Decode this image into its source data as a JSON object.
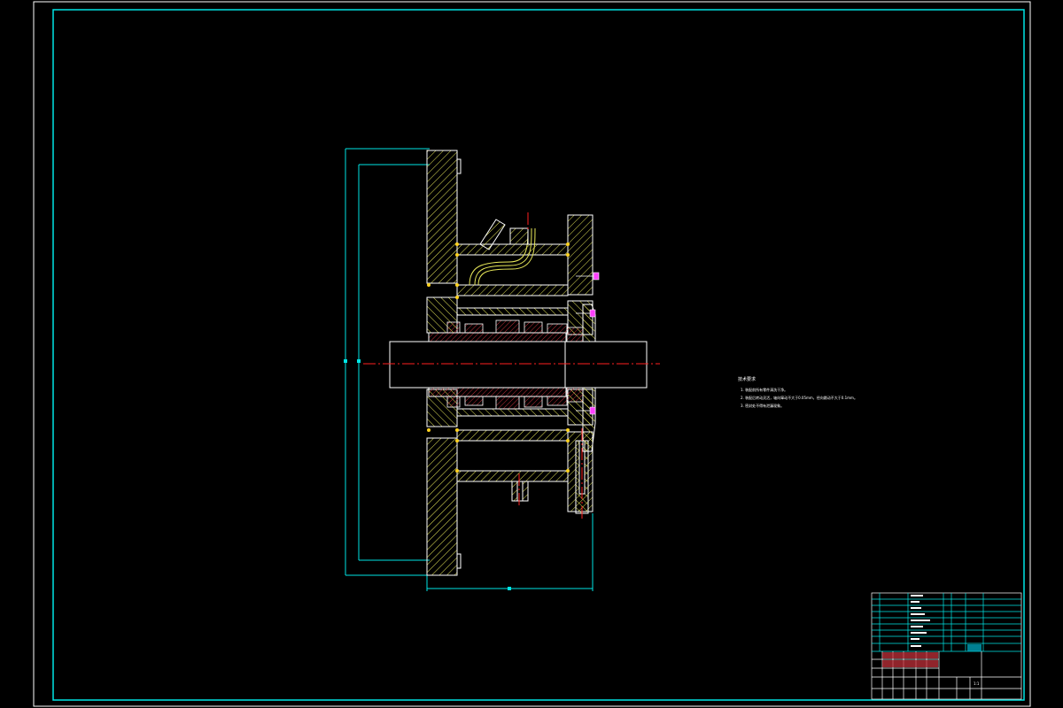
{
  "drawing": {
    "background": "#000000",
    "frame_color": "#00e5e5",
    "outline_color": "#ffffff",
    "hatch_color": "#e8e85a",
    "centerline_color": "#ff2020",
    "dimension_color": "#00e5e5",
    "accent_red": "#c0303a",
    "accent_magenta": "#ff40ff",
    "weld_color": "#ffd21e"
  },
  "technical_notes": {
    "title": "技术要求",
    "items": [
      "1. 装配前所有零件清洗干净。",
      "2. 装配后转动灵活，轴向窜动不大于0.05mm，径向跳动不大于0.1mm。",
      "3. 密封处不得有泄漏现象。"
    ]
  },
  "title_block": {
    "parts_rows": [
      {
        "no": "1",
        "name": "",
        "qty": "1",
        "material": ""
      },
      {
        "no": "2",
        "name": "",
        "qty": "1",
        "material": ""
      },
      {
        "no": "3",
        "name": "",
        "qty": "1",
        "material": ""
      },
      {
        "no": "4",
        "name": "",
        "qty": "1",
        "material": ""
      },
      {
        "no": "5",
        "name": "",
        "qty": "1",
        "material": ""
      },
      {
        "no": "6",
        "name": "",
        "qty": "1",
        "material": ""
      },
      {
        "no": "7",
        "name": "",
        "qty": "1",
        "material": ""
      },
      {
        "no": "8",
        "name": "",
        "qty": "1",
        "material": ""
      },
      {
        "no": "9",
        "name": "",
        "qty": "1",
        "material": ""
      },
      {
        "no": "10",
        "name": "",
        "qty": "1",
        "material": ""
      }
    ],
    "header_cells": [
      "序号",
      "代号",
      "名称",
      "数量",
      "材料",
      "备注"
    ],
    "scale": "1:1"
  }
}
